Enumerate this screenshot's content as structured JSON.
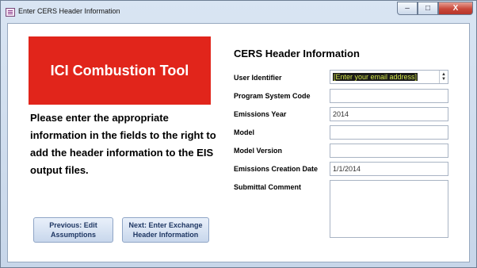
{
  "window": {
    "title": "Enter CERS Header Information",
    "buttons": {
      "minimize": "–",
      "maximize": "□",
      "close": "X"
    }
  },
  "banner": {
    "title": "ICI Combustion Tool",
    "color": "#e1251b"
  },
  "instructions": "Please enter the appropriate information in the fields to the right to add the header information to the EIS output files.",
  "form": {
    "title": "CERS Header Information",
    "fields": {
      "user_identifier": {
        "label": "User Identifier",
        "value": "[Enter your email address]"
      },
      "program_system_code": {
        "label": "Program System Code",
        "value": ""
      },
      "emissions_year": {
        "label": "Emissions Year",
        "value": "2014"
      },
      "model": {
        "label": "Model",
        "value": ""
      },
      "model_version": {
        "label": "Model Version",
        "value": ""
      },
      "emissions_creation_date": {
        "label": "Emissions Creation Date",
        "value": "1/1/2014"
      },
      "submittal_comment": {
        "label": "Submittal Comment",
        "value": ""
      }
    }
  },
  "nav": {
    "prev_line1": "Previous: Edit",
    "prev_line2": "Assumptions",
    "next_line1": "Next: Enter Exchange",
    "next_line2": "Header Information"
  }
}
